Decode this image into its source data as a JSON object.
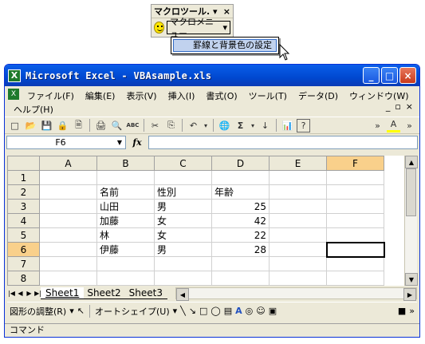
{
  "macro_toolbar": {
    "title": "マクロツール",
    "title_suffix": ". ▾",
    "close": "×",
    "menu_button": "マクロメニュー",
    "menu_arrow": "▾",
    "dropdown_item": "罫線と背景色の設定"
  },
  "window": {
    "title": "Microsoft Excel - VBAsample.xls",
    "icon_letter": "X",
    "minimize": "_",
    "maximize": "□",
    "close": "×"
  },
  "menubar": {
    "items": [
      "ファイル(F)",
      "編集(E)",
      "表示(V)",
      "挿入(I)",
      "書式(O)",
      "ツール(T)",
      "データ(D)",
      "ウィンドウ(W)",
      "ヘルプ(H)"
    ],
    "mdi_min": "_",
    "mdi_restore": "▫",
    "mdi_close": "×"
  },
  "toolbar": {
    "icons": [
      "□",
      "📂",
      "💾",
      "🔒",
      "🗎",
      "🖨",
      "🔍",
      "ABC",
      "✂",
      "⎘",
      "↶",
      "🌐",
      "Σ",
      "↓",
      "📊",
      "?",
      "»",
      "A",
      "»"
    ]
  },
  "formula_bar": {
    "name_box": "F6",
    "fx": "fx",
    "value": ""
  },
  "sheet": {
    "columns": [
      "A",
      "B",
      "C",
      "D",
      "E",
      "F"
    ],
    "selected_column": "F",
    "selected_row": "6",
    "rows": [
      {
        "num": "1",
        "cells": [
          "",
          "",
          "",
          "",
          "",
          ""
        ]
      },
      {
        "num": "2",
        "cells": [
          "",
          "名前",
          "性別",
          "年齢",
          "",
          ""
        ]
      },
      {
        "num": "3",
        "cells": [
          "",
          "山田",
          "男",
          "25",
          "",
          ""
        ]
      },
      {
        "num": "4",
        "cells": [
          "",
          "加藤",
          "女",
          "42",
          "",
          ""
        ]
      },
      {
        "num": "5",
        "cells": [
          "",
          "林",
          "女",
          "22",
          "",
          ""
        ]
      },
      {
        "num": "6",
        "cells": [
          "",
          "伊藤",
          "男",
          "28",
          "",
          ""
        ]
      },
      {
        "num": "7",
        "cells": [
          "",
          "",
          "",
          "",
          "",
          ""
        ]
      },
      {
        "num": "8",
        "cells": [
          "",
          "",
          "",
          "",
          "",
          ""
        ]
      }
    ]
  },
  "tabs": {
    "sheets": [
      "Sheet1",
      "Sheet2",
      "Sheet3"
    ],
    "active": "Sheet1"
  },
  "drawing_bar": {
    "draw_menu": "図形の調整(R)",
    "autoshape": "オートシェイプ(U)"
  },
  "status": {
    "text": "コマンド"
  }
}
